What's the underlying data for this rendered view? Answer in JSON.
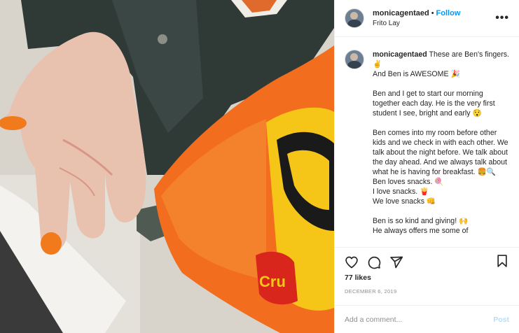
{
  "post": {
    "username": "monicagentaed",
    "separator": "•",
    "follow_label": "Follow",
    "location": "Frito Lay",
    "more_icon": "more-options-icon",
    "more_label": "•••"
  },
  "caption": {
    "username": "monicagentaed",
    "text": " These are Ben's fingers. ✌\nAnd Ben is AWESOME 🎉\n\nBen and I get to start our morning together each day. He is the very first student I see, bright and early 😯\n\nBen comes into my room before other kids and we check in with each other. We talk about the night before. We talk about the day ahead. And we always talk about what he is having for breakfast. 🍔🔍 Ben loves snacks. 🍭\nI love snacks. 🍟\nWe love snacks 👊\n\nBen is so kind and giving! 🙌\nHe always offers me some of"
  },
  "actions": {
    "icons": [
      "heart-icon",
      "comment-icon",
      "share-icon",
      "bookmark-icon"
    ],
    "likes": "77 likes",
    "date": "DECEMBER 6, 2019"
  },
  "comment": {
    "placeholder": "Add a comment...",
    "post_label": "Post"
  },
  "colors": {
    "follow": "#0095f6",
    "post_disabled": "#b2dffc",
    "bag_orange": "#f26d1d",
    "chip_yellow": "#f5c518"
  }
}
